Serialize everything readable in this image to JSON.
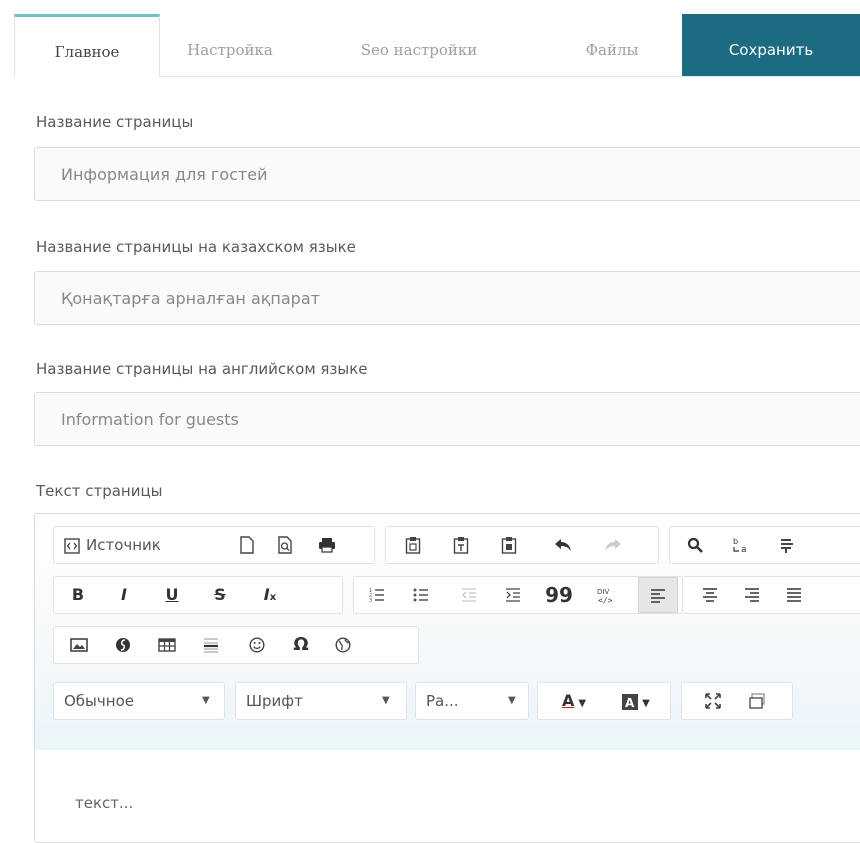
{
  "tabs": {
    "main": "Главное",
    "settings": "Настройка",
    "seo": "Seo настройки",
    "files": "Файлы",
    "save": "Сохранить"
  },
  "form": {
    "title_label": "Название страницы",
    "title_value": "Информация для гостей",
    "kz_label": "Название страницы на казахском языке",
    "kz_value": "Қонақтарға арналған ақпарат",
    "en_label": "Название страницы на английском языке",
    "en_value": "Information for guests",
    "text_label": "Текст страницы"
  },
  "editor": {
    "source_label": "Источник",
    "format_label": "Обычное",
    "font_label": "Шрифт",
    "size_label": "Ра...",
    "text_color_glyph": "A",
    "content": "текст..."
  },
  "colors": {
    "save_bg": "#1d6b83",
    "active_tab_border": "#6cc3c8"
  }
}
